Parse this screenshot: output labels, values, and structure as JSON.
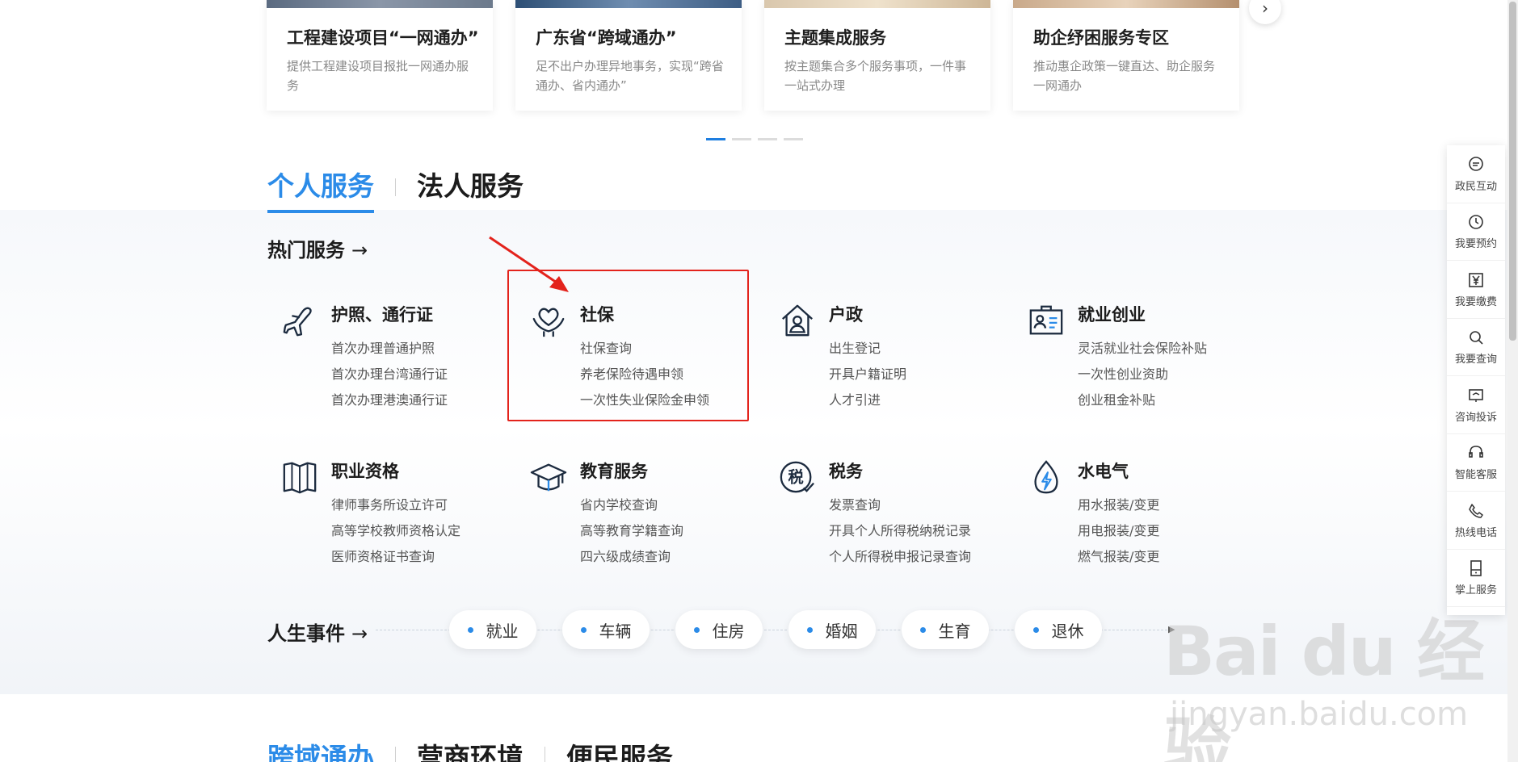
{
  "top_cards": [
    {
      "title": "工程建设项目“一网通办”",
      "desc": "提供工程建设项目报批一网通办服务"
    },
    {
      "title": "广东省“跨域通办”",
      "desc": "足不出户办理异地事务，实现“跨省通办、省内通办”"
    },
    {
      "title": "主题集成服务",
      "desc": "按主题集合多个服务事项，一件事一站式办理"
    },
    {
      "title": "助企纾困服务专区",
      "desc": "推动惠企政策一键直达、助企服务一网通办"
    }
  ],
  "carousel": {
    "next": "›"
  },
  "tabs": {
    "personal": "个人服务",
    "legal": "法人服务"
  },
  "hot": {
    "title": "热门服务",
    "arrow": "→"
  },
  "services": [
    {
      "name": "护照、通行证",
      "items": [
        "首次办理普通护照",
        "首次办理台湾通行证",
        "首次办理港澳通行证"
      ]
    },
    {
      "name": "社保",
      "items": [
        "社保查询",
        "养老保险待遇申领",
        "一次性失业保险金申领"
      ]
    },
    {
      "name": "户政",
      "items": [
        "出生登记",
        "开具户籍证明",
        "人才引进"
      ]
    },
    {
      "name": "就业创业",
      "items": [
        "灵活就业社会保险补贴",
        "一次性创业资助",
        "创业租金补贴"
      ]
    },
    {
      "name": "职业资格",
      "items": [
        "律师事务所设立许可",
        "高等学校教师资格认定",
        "医师资格证书查询"
      ]
    },
    {
      "name": "教育服务",
      "items": [
        "省内学校查询",
        "高等教育学籍查询",
        "四六级成绩查询"
      ]
    },
    {
      "name": "税务",
      "items": [
        "发票查询",
        "开具个人所得税纳税记录",
        "个人所得税申报记录查询"
      ]
    },
    {
      "name": "水电气",
      "items": [
        "用水报装/变更",
        "用电报装/变更",
        "燃气报装/变更"
      ]
    }
  ],
  "tax_icon_char": "税",
  "life": {
    "title": "人生事件",
    "arrow": "→",
    "events": [
      "就业",
      "车辆",
      "住房",
      "婚姻",
      "生育",
      "退休"
    ]
  },
  "bottom_tabs": [
    "跨域通办",
    "营商环境",
    "便民服务"
  ],
  "float_bar": [
    "政民互动",
    "我要预约",
    "我要缴费",
    "我要查询",
    "咨询投诉",
    "智能客服",
    "热线电话",
    "掌上服务"
  ],
  "watermark": {
    "main": "Bai du 经验",
    "sub": "jingyan.baidu.com"
  },
  "colors": {
    "accent": "#2b8be8",
    "highlight": "#e3231c"
  }
}
